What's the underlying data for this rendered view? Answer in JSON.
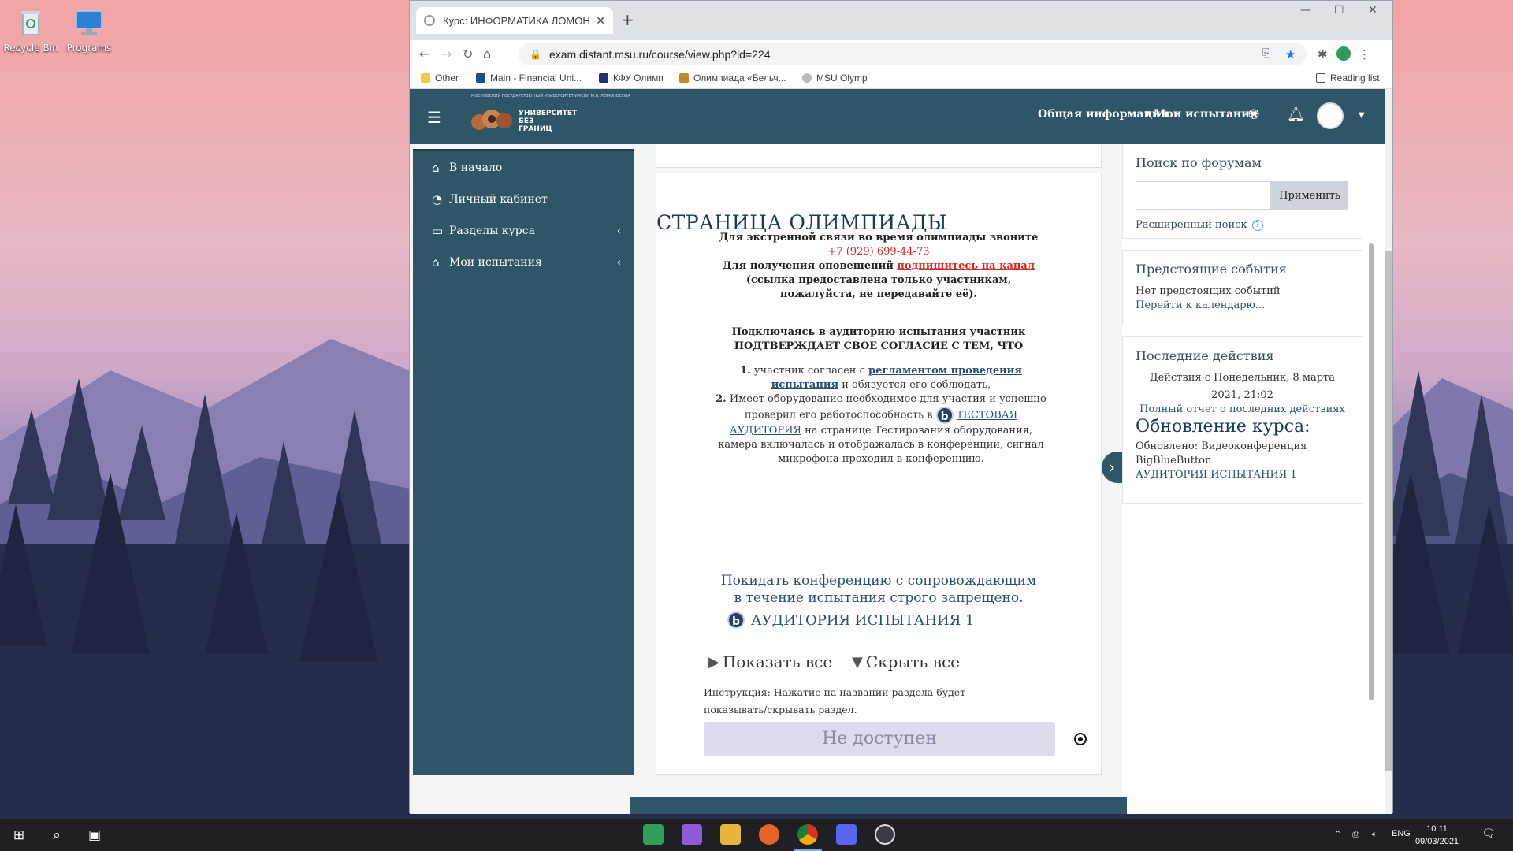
{
  "desktop": {
    "icons": [
      {
        "label": "Recycle Bin",
        "icon": "recycle-bin-icon"
      },
      {
        "label": "Programs",
        "icon": "monitor-icon"
      }
    ]
  },
  "browser": {
    "tab_title": "Курс: ИНФОРМАТИКА ЛОМОН",
    "url": "exam.distant.msu.ru/course/view.php?id=224",
    "bookmarks": [
      "Other",
      "Main - Financial Uni...",
      "КФУ Олимп",
      "Олимпиада «Бельч...",
      "MSU Olymp"
    ],
    "reading_list": "Reading list"
  },
  "site": {
    "logo_text": "УНИВЕРСИТЕТ\nБЕЗ\nГРАНИЦ",
    "logo_small": "МОСКОВСКИЙ ГОСУДАРСТВЕННЫЙ УНИВЕРСИТЕТ ИМЕНИ М.В. ЛОМОНОСОВА",
    "nav": {
      "general_info": "Общая информация",
      "my_tests": "Мои испытания"
    },
    "sidebar": [
      {
        "label": "В начало",
        "icon": "home-icon"
      },
      {
        "label": "Личный кабинет",
        "icon": "dashboard-icon"
      },
      {
        "label": "Разделы курса",
        "icon": "folder-icon"
      },
      {
        "label": "Мои испытания",
        "icon": "graduation-cap-icon"
      }
    ],
    "content": {
      "title": "СТРАНИЦА ОЛИМПИАДЫ",
      "emergency": "Для экстренной связи во время олимпиады звоните",
      "phone": "+7 (929) 699-44-73",
      "notify_prefix": "Для получения оповещений",
      "notify_link": "подпишитесь на канал",
      "notify_note1": "(ссылка предоставлена только участникам,",
      "notify_note2": "пожалуйста, не передавайте её).",
      "agree1": "Подключаясь в аудиторию испытания участник",
      "agree2": "ПОДТВЕРЖДАЕТ СВОЕ СОГЛАСИЕ С ТЕМ, ЧТО",
      "item1_num": "1.",
      "item1_pre": "участник согласен с",
      "item1_link": "регламентом проведения испытания",
      "item1_post": "и обязуется его соблюдать,",
      "item2_num": "2.",
      "item2_pre": "Имеет оборудование необходимое для участия и успешно проверил его работоспособность в",
      "item2_link": "ТЕСТОВАЯ АУДИТОРИЯ",
      "item2_post": "на странице Тестирования оборудования, камера включалась и отображалась в конференции, сигнал микрофона проходил в конференцию.",
      "warning1": "Покидать конференцию с сопровождающим",
      "warning2": "в течение испытания строго запрещено.",
      "room_link": "АУДИТОРИЯ ИСПЫТАНИЯ 1",
      "show_all": "Показать все",
      "hide_all": "Скрыть все",
      "instruction": "Инструкция: Нажатие на названии раздела будет показывать/скрывать раздел.",
      "not_available": "Не доступен"
    },
    "blocks": {
      "forum_search": {
        "title": "Поиск по форумам",
        "button": "Применить",
        "input_value": "",
        "advanced": "Расширенный поиск"
      },
      "upcoming": {
        "title": "Предстоящие события",
        "none": "Нет предстоящих событий",
        "calendar_link": "Перейти к календарю..."
      },
      "recent": {
        "title": "Последние действия",
        "since": "Действия с Понедельник, 8 марта 2021, 21:02",
        "full_report": "Полный отчет о последних действиях",
        "update_heading": "Обновление курса:",
        "updated": "Обновлено: Видеоконференция BigBlueButton",
        "updated_link": "АУДИТОРИЯ ИСПЫТАНИЯ 1"
      }
    }
  },
  "taskbar": {
    "lang": "ENG",
    "time": "10:11",
    "date": "09/03/2021"
  },
  "colors": {
    "site_header": "#2f5667",
    "link_red": "#d32a2a",
    "link_blue": "#2b4f72"
  }
}
